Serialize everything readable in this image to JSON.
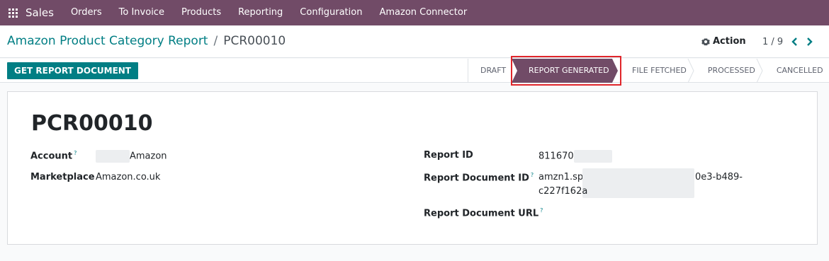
{
  "navbar": {
    "app_name": "Sales",
    "menu": [
      "Orders",
      "To Invoice",
      "Products",
      "Reporting",
      "Configuration",
      "Amazon Connector"
    ]
  },
  "breadcrumb": {
    "parent": "Amazon Product Category Report",
    "separator": "/",
    "current": "PCR00010"
  },
  "toolbar": {
    "action_label": "Action",
    "pager": "1 / 9"
  },
  "header": {
    "primary_button": "GET REPORT DOCUMENT",
    "stages": [
      "DRAFT",
      "REPORT GENERATED",
      "FILE FETCHED",
      "PROCESSED",
      "CANCELLED"
    ],
    "active_stage": "REPORT GENERATED"
  },
  "record": {
    "name": "PCR00010",
    "fields": {
      "account": {
        "label": "Account",
        "help": "?",
        "value": "Amazon"
      },
      "marketplace": {
        "label": "Marketplace",
        "value": "Amazon.co.uk"
      },
      "report_id": {
        "label": "Report ID",
        "value": "811670"
      },
      "report_document_id": {
        "label": "Report Document ID",
        "help": "?",
        "value_line1_start": "amzn1.spd",
        "value_line1_end": "0e3-b489-",
        "value_line2_start": "c227f162a"
      },
      "report_document_url": {
        "label": "Report Document URL",
        "help": "?",
        "value": ""
      }
    }
  },
  "colors": {
    "brand": "#714b67",
    "accent": "#017e84",
    "active_stage": "#714b67",
    "highlight": "#e0262b"
  }
}
